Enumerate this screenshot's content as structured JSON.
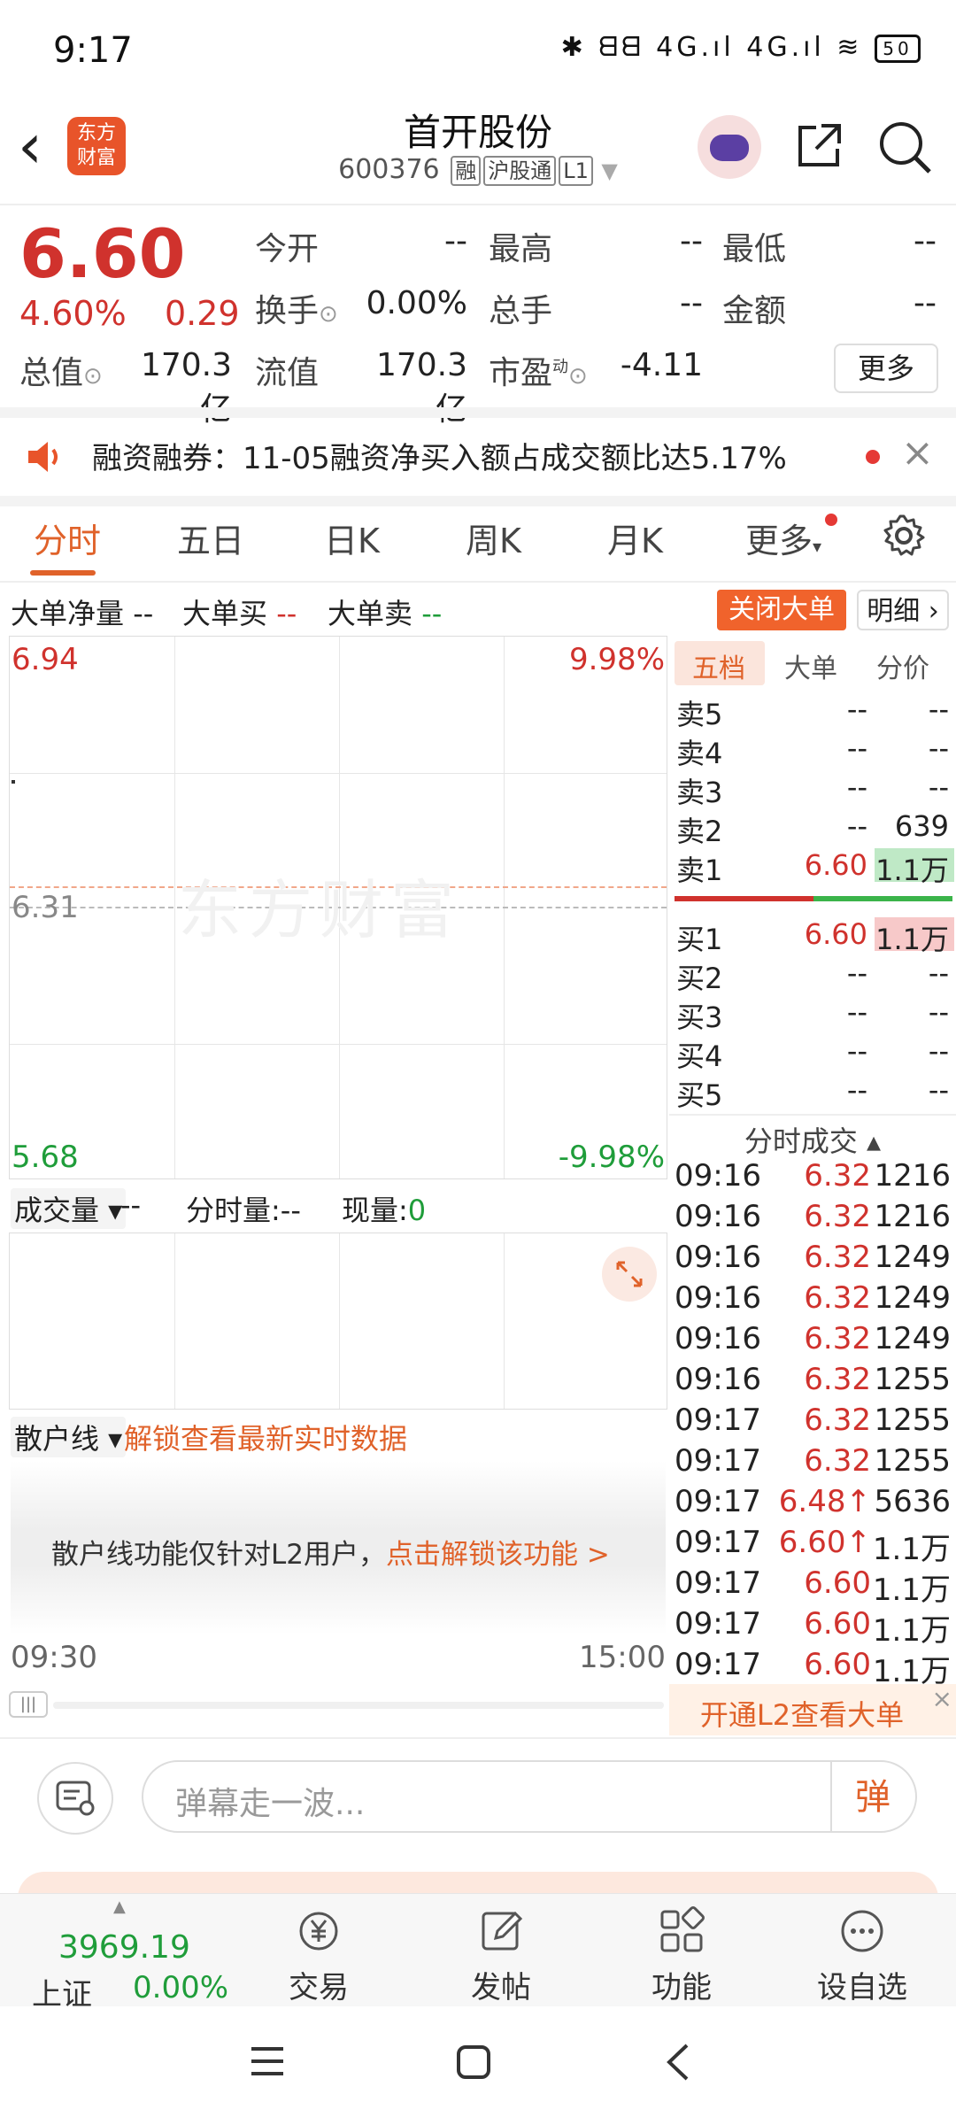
{
  "status_bar": {
    "time": "9:17",
    "icons": "✱ ᗺᗺ 4G.ıl 4G.ıl ≋",
    "battery": "50"
  },
  "header": {
    "logo_text": "东方\n财富",
    "stock_name": "首开股份",
    "stock_code": "600376",
    "tags": [
      "融",
      "沪股通",
      "L1"
    ]
  },
  "quote": {
    "price": "6.60",
    "change_pct": "4.60%",
    "change": "0.29",
    "fields": [
      {
        "label": "今开",
        "value": "--"
      },
      {
        "label": "最高",
        "value": "--"
      },
      {
        "label": "最低",
        "value": "--"
      },
      {
        "label": "换手",
        "value": "0.00%"
      },
      {
        "label": "总手",
        "value": "--"
      },
      {
        "label": "金额",
        "value": "--"
      },
      {
        "label": "总值",
        "value": "170.3亿"
      },
      {
        "label": "流值",
        "value": "170.3亿"
      },
      {
        "label": "市盈",
        "sup": "动",
        "value": "-4.11"
      }
    ],
    "more_label": "更多"
  },
  "notice": {
    "text": "融资融券：11-05融资净买入额占成交额比达5.17%"
  },
  "tabs": [
    {
      "label": "分时",
      "active": true
    },
    {
      "label": "五日"
    },
    {
      "label": "日K"
    },
    {
      "label": "周K"
    },
    {
      "label": "月K"
    },
    {
      "label": "更多"
    }
  ],
  "indicators": {
    "net_label": "大单净量",
    "net_value": "--",
    "buy_label": "大单买",
    "buy_value": "--",
    "sell_label": "大单卖",
    "sell_value": "--",
    "close_big_label": "关闭大单",
    "detail_label": "明细 ›"
  },
  "chart": {
    "watermark": "东方财富",
    "y_top": "6.94",
    "y_mid": "6.31",
    "y_bottom": "5.68",
    "pct_top": "9.98%",
    "pct_bottom": "-9.98%",
    "x_start": "09:30",
    "x_end": "15:00"
  },
  "volume": {
    "select_label": "成交量 ▾",
    "select_value": "--",
    "period_label": "分时量:--",
    "current_label": "现量:",
    "current_value": "0"
  },
  "retail": {
    "select_label": "散户线 ▾",
    "unlock_label": "解锁查看最新实时数据",
    "info_text": "散户线功能仅针对L2用户，",
    "info_link": "点击解锁该功能 >"
  },
  "order_book": {
    "tabs": [
      "五档",
      "大单",
      "分价"
    ],
    "asks": [
      {
        "label": "卖5",
        "price": "--",
        "volume": "--"
      },
      {
        "label": "卖4",
        "price": "--",
        "volume": "--"
      },
      {
        "label": "卖3",
        "price": "--",
        "volume": "--"
      },
      {
        "label": "卖2",
        "price": "--",
        "volume": "639"
      },
      {
        "label": "卖1",
        "price": "6.60",
        "volume": "1.1万"
      }
    ],
    "bids": [
      {
        "label": "买1",
        "price": "6.60",
        "volume": "1.1万"
      },
      {
        "label": "买2",
        "price": "--",
        "volume": "--"
      },
      {
        "label": "买3",
        "price": "--",
        "volume": "--"
      },
      {
        "label": "买4",
        "price": "--",
        "volume": "--"
      },
      {
        "label": "买5",
        "price": "--",
        "volume": "--"
      }
    ]
  },
  "trades": {
    "title": "分时成交 ▴",
    "rows": [
      {
        "time": "09:16",
        "price": "6.32",
        "volume": "1216"
      },
      {
        "time": "09:16",
        "price": "6.32",
        "volume": "1216"
      },
      {
        "time": "09:16",
        "price": "6.32",
        "volume": "1249"
      },
      {
        "time": "09:16",
        "price": "6.32",
        "volume": "1249"
      },
      {
        "time": "09:16",
        "price": "6.32",
        "volume": "1249"
      },
      {
        "time": "09:16",
        "price": "6.32",
        "volume": "1255"
      },
      {
        "time": "09:17",
        "price": "6.32",
        "volume": "1255"
      },
      {
        "time": "09:17",
        "price": "6.32",
        "volume": "1255"
      },
      {
        "time": "09:17",
        "price": "6.48↑",
        "volume": "5636"
      },
      {
        "time": "09:17",
        "price": "6.60↑",
        "volume": "1.1万"
      },
      {
        "time": "09:17",
        "price": "6.60",
        "volume": "1.1万"
      },
      {
        "time": "09:17",
        "price": "6.60",
        "volume": "1.1万"
      },
      {
        "time": "09:17",
        "price": "6.60",
        "volume": "1.1万"
      }
    ],
    "l2_banner": "开通L2查看大单"
  },
  "comment": {
    "placeholder": "弹幕走一波...",
    "danmu_label": "弹"
  },
  "bottom_nav": {
    "index_value": "3969.19",
    "index_name": "上证",
    "index_change": "0.00%",
    "items": [
      "交易",
      "发帖",
      "功能",
      "设自选"
    ]
  },
  "colors": {
    "up": "#d0322d",
    "down": "#1f9d3a",
    "accent": "#e0622a"
  }
}
